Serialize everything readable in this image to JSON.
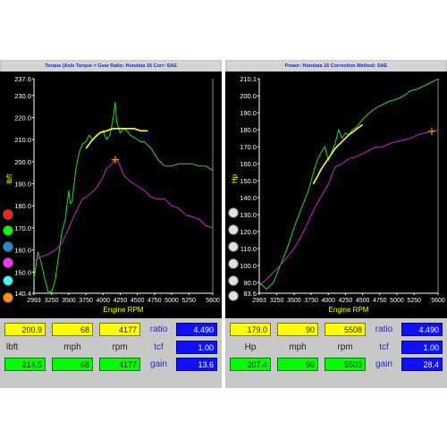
{
  "colors": {
    "background": "#000000",
    "green": "#22dd22",
    "magenta": "#cc22cc",
    "yellow": "#ffff22",
    "cursor": "#ff9900",
    "axis_text": "#ffffff",
    "axis_title": "#ffff00",
    "header_text": "#1e2cb8",
    "left_dots": [
      "#ff2020",
      "#00ff00",
      "#1e90c8",
      "#ff30ff",
      "#40ffff",
      "#ff9010"
    ],
    "right_dots": [
      "#e0e0e0",
      "#e0e0e0",
      "#e0e0e0",
      "#e0e0e0",
      "#e0e0e0",
      "#e0e0e0"
    ]
  },
  "left": {
    "header": "Torque (Axle Torque = Gear Ratio: Hondata 16     Corr: SAE",
    "readouts": {
      "row1": {
        "yellow1": "200.9",
        "yellow2": "68",
        "yellow3": "4177",
        "label": "ratio",
        "blue": "4.490"
      },
      "row2": {
        "label1": "lbft",
        "label2": "mph",
        "label3": "rpm",
        "label": "tcf",
        "blue": "1.00"
      },
      "row3": {
        "green1": "214.5",
        "green2": "68",
        "green3": "4177",
        "label": "gain",
        "blue": "13.6"
      }
    }
  },
  "right": {
    "header": "Power: Hondata 16       Correction Method: SAE",
    "readouts": {
      "row1": {
        "yellow1": "179.0",
        "yellow2": "90",
        "yellow3": "5508",
        "label": "ratio",
        "blue": "4.490"
      },
      "row2": {
        "label1": "Hp",
        "label2": "mph",
        "label3": "rpm",
        "label": "tcf",
        "blue": "1.00"
      },
      "row3": {
        "green1": "207.4",
        "green2": "90",
        "green3": "5503",
        "label": "gain",
        "blue": "28.4"
      }
    }
  },
  "chart_data": [
    {
      "type": "line",
      "xlabel": "Engine RPM",
      "ylabel": "lbft",
      "xlim": [
        2993,
        5600
      ],
      "ylim": [
        140.4,
        237.6
      ],
      "x_ticks": [
        "2993",
        "3250",
        "3500",
        "3750",
        "4000",
        "4250",
        "4500",
        "4750",
        "5000",
        "5250",
        "5600"
      ],
      "y_ticks": [
        "237.6",
        "230.0",
        "220.0",
        "210.0",
        "200.0",
        "190.0",
        "180.0",
        "170.0",
        "160.0",
        "150.0",
        "140.4"
      ],
      "tick_values_x": [
        2993,
        3250,
        3500,
        3750,
        4000,
        4250,
        4500,
        4750,
        5000,
        5250,
        5600
      ],
      "tick_values_y": [
        237.6,
        230,
        220,
        210,
        200,
        190,
        180,
        170,
        160,
        150,
        140.4
      ],
      "cursor": {
        "x": 4177,
        "y": 200.9
      },
      "series": [
        {
          "color": "green",
          "x": [
            2993,
            3050,
            3100,
            3150,
            3200,
            3250,
            3300,
            3350,
            3400,
            3450,
            3500,
            3520,
            3550,
            3600,
            3650,
            3700,
            3750,
            3800,
            3850,
            3900,
            3950,
            4000,
            4050,
            4100,
            4150,
            4177,
            4200,
            4250,
            4300,
            4350,
            4400,
            4450,
            4500,
            4550,
            4600,
            4700,
            4800,
            4900,
            5000,
            5100,
            5200,
            5300,
            5400,
            5500,
            5600
          ],
          "values": [
            147,
            159,
            154,
            147,
            141,
            141,
            146,
            157,
            168,
            174,
            187,
            181,
            182,
            196,
            204,
            208,
            209,
            212,
            210,
            212,
            213,
            214,
            210,
            212,
            220,
            227,
            218,
            213,
            215,
            214,
            212,
            211,
            210,
            209,
            209,
            206,
            201,
            198,
            198,
            199,
            199,
            199,
            198,
            198,
            196
          ]
        },
        {
          "color": "magenta",
          "x": [
            2993,
            3100,
            3200,
            3300,
            3400,
            3500,
            3600,
            3700,
            3800,
            3900,
            4000,
            4050,
            4100,
            4150,
            4177,
            4200,
            4250,
            4300,
            4400,
            4500,
            4600,
            4700,
            4800,
            4900,
            5000,
            5100,
            5200,
            5300,
            5400,
            5500,
            5600
          ],
          "values": [
            155,
            157,
            158,
            160,
            163,
            170,
            177,
            183,
            185,
            188,
            193,
            197,
            198,
            200,
            201,
            201,
            198,
            194,
            191,
            189,
            187,
            184,
            183,
            183,
            180,
            179,
            176,
            175,
            174,
            171,
            170
          ]
        },
        {
          "color": "yellow",
          "x": [
            3750,
            3850,
            3950,
            4050,
            4150,
            4250,
            4350,
            4450,
            4550,
            4650
          ],
          "values": [
            206,
            210,
            213,
            214,
            215,
            215,
            215,
            215,
            214,
            214
          ]
        }
      ]
    },
    {
      "type": "line",
      "xlabel": "Engine RPM",
      "ylabel": "Hp",
      "xlim": [
        2993,
        5600
      ],
      "ylim": [
        83.6,
        210.1
      ],
      "x_ticks": [
        "2993",
        "3250",
        "3500",
        "3750",
        "4000",
        "4250",
        "4500",
        "4750",
        "5000",
        "5250",
        "5600"
      ],
      "y_ticks": [
        "210.1",
        "200.0",
        "190.0",
        "180.0",
        "170.0",
        "160.0",
        "150.0",
        "140.0",
        "130.0",
        "120.0",
        "110.0",
        "100.0",
        "90.0",
        "83.6"
      ],
      "tick_values_x": [
        2993,
        3250,
        3500,
        3750,
        4000,
        4250,
        4500,
        4750,
        5000,
        5250,
        5600
      ],
      "tick_values_y": [
        210.1,
        200,
        190,
        180,
        170,
        160,
        150,
        140,
        130,
        120,
        110,
        100,
        90,
        83.6
      ],
      "cursor": {
        "x": 5508,
        "y": 179.0
      },
      "series": [
        {
          "color": "green",
          "x": [
            2993,
            3100,
            3200,
            3300,
            3400,
            3500,
            3600,
            3700,
            3750,
            3800,
            3850,
            3900,
            3950,
            4000,
            4100,
            4150,
            4200,
            4250,
            4300,
            4350,
            4400,
            4500,
            4600,
            4700,
            4800,
            4900,
            5000,
            5100,
            5200,
            5300,
            5400,
            5500,
            5600
          ],
          "values": [
            90,
            86,
            90,
            100,
            110,
            122,
            133,
            143,
            150,
            157,
            163,
            167,
            170,
            162,
            172,
            180,
            175,
            178,
            177,
            180,
            181,
            186,
            190,
            193,
            195,
            197,
            198,
            200,
            203,
            204,
            206,
            208,
            210
          ]
        },
        {
          "color": "magenta",
          "x": [
            2993,
            3100,
            3200,
            3300,
            3400,
            3500,
            3600,
            3700,
            3800,
            3900,
            4000,
            4100,
            4200,
            4300,
            4400,
            4500,
            4600,
            4700,
            4800,
            4900,
            5000,
            5100,
            5200,
            5300,
            5400,
            5500,
            5600
          ],
          "values": [
            88,
            92,
            96,
            100,
            105,
            110,
            117,
            125,
            134,
            141,
            148,
            158,
            160,
            163,
            164,
            166,
            168,
            170,
            170,
            172,
            173,
            174,
            175,
            177,
            178,
            179,
            180
          ]
        },
        {
          "color": "yellow",
          "x": [
            3780,
            3850,
            3900,
            3950,
            4000,
            4100,
            4200,
            4300,
            4400,
            4500
          ],
          "values": [
            148,
            153,
            157,
            160,
            163,
            169,
            173,
            177,
            180,
            183
          ]
        }
      ]
    }
  ]
}
